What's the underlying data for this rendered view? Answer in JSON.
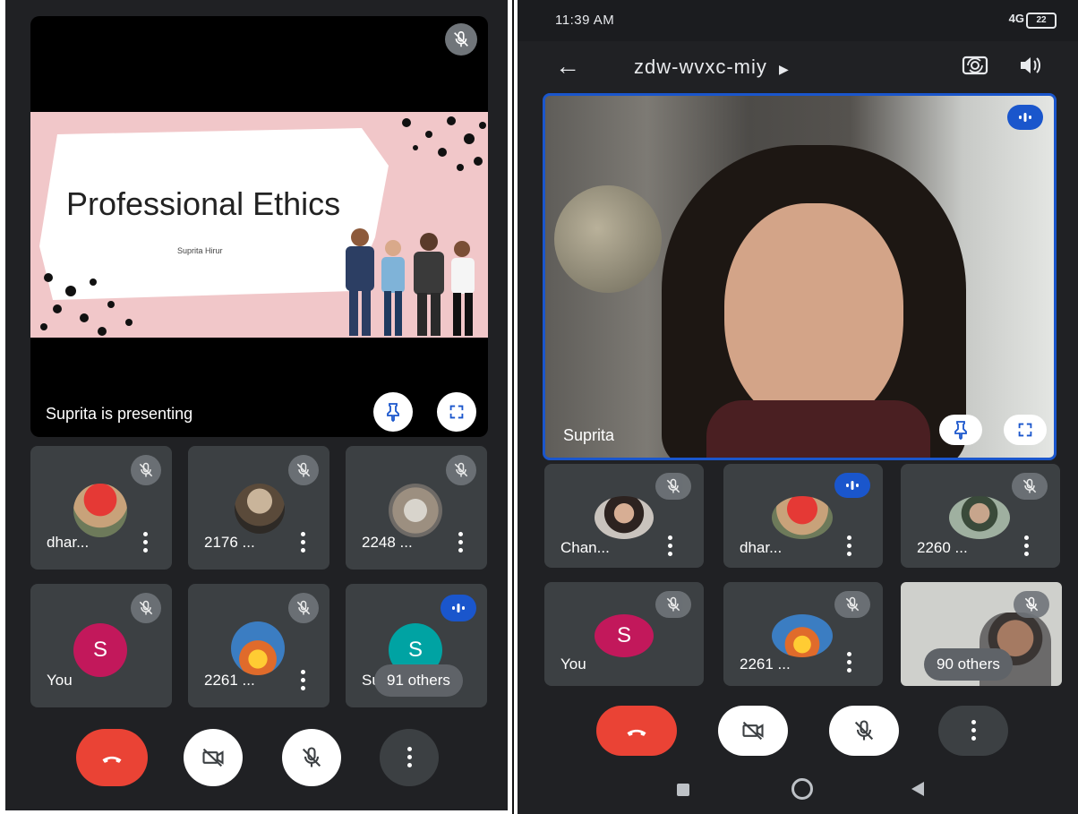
{
  "left": {
    "presentation": {
      "slide_title": "Professional Ethics",
      "slide_author": "Suprita Hirur",
      "presenting_label": "Suprita is presenting"
    },
    "participants": [
      {
        "name": "dhar...",
        "avatar": "turban-photo",
        "status": "muted"
      },
      {
        "name": "2176 ...",
        "avatar": "person-photo",
        "status": "muted"
      },
      {
        "name": "2248 ...",
        "avatar": "cat-photo",
        "status": "muted"
      },
      {
        "name": "You",
        "avatar_letter": "S",
        "avatar_color": "#c2185b",
        "status": "muted"
      },
      {
        "name": "2261 ...",
        "avatar": "fire-photo",
        "status": "muted"
      },
      {
        "name": "Su",
        "avatar_letter": "S",
        "avatar_color": "#00a3a3",
        "status": "speaking"
      }
    ],
    "others_chip": "91 others"
  },
  "right": {
    "status_bar": {
      "time": "11:39 AM",
      "network": "4G",
      "battery": "22"
    },
    "meeting_code": "zdw-wvxc-miy",
    "main_speaker": "Suprita",
    "participants": [
      {
        "name": "Chan...",
        "avatar": "woman-photo",
        "status": "muted"
      },
      {
        "name": "dhar...",
        "avatar": "turban-photo",
        "status": "speaking"
      },
      {
        "name": "2260 ...",
        "avatar": "man-photo",
        "status": "muted"
      },
      {
        "name": "You",
        "avatar_letter": "S",
        "avatar_color": "#c2185b",
        "status": "muted"
      },
      {
        "name": "2261 ...",
        "avatar": "fire-photo",
        "status": "muted"
      },
      {
        "name": "",
        "avatar": "video-feed",
        "status": "muted"
      }
    ],
    "others_chip": "90 others"
  },
  "icons": {
    "end_call": "phone-hangup-icon",
    "camera_off": "video-off-icon",
    "mic_off": "mic-off-icon",
    "more": "more-vert-icon",
    "pin": "pin-icon",
    "fullscreen": "fullscreen-icon"
  },
  "colors": {
    "background": "#202124",
    "tile": "#3c4043",
    "end_call": "#ea4335",
    "speaking": "#1a56cc"
  }
}
